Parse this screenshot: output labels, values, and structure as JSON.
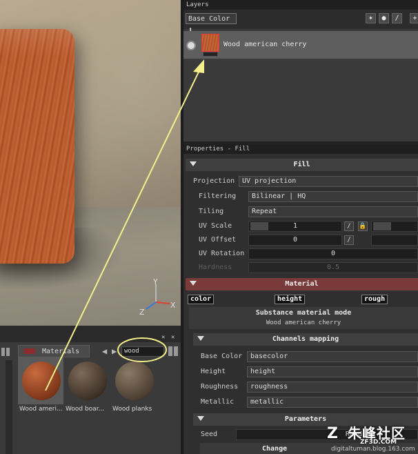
{
  "viewport": {
    "axes": {
      "y": "Y",
      "z": "Z",
      "x": "X"
    }
  },
  "layers": {
    "title": "Layers",
    "blend_mode": "Base Color ⬍",
    "tools": [
      "✶",
      "●",
      "∕",
      "+"
    ],
    "layer": {
      "name": "Wood american cherry"
    }
  },
  "properties": {
    "title": "Properties - Fill",
    "fill": {
      "title": "Fill",
      "projection": {
        "label": "Projection",
        "value": "UV projection"
      },
      "filtering": {
        "label": "Filtering",
        "value": "Bilinear | HQ"
      },
      "tiling": {
        "label": "Tiling",
        "value": "Repeat"
      },
      "uv_scale": {
        "label": "UV Scale",
        "value": "1"
      },
      "uv_offset": {
        "label": "UV Offset",
        "value": "0"
      },
      "uv_rotation": {
        "label": "UV Rotation",
        "value": "0"
      },
      "hardness": {
        "label": "Hardness",
        "value": "0.5"
      }
    },
    "material": {
      "title": "Material",
      "channels": [
        "color",
        "height",
        "rough"
      ],
      "mode_title": "Substance material mode",
      "mode_value": "Wood american cherry"
    },
    "channels_mapping": {
      "title": "Channels mapping",
      "rows": [
        {
          "label": "Base Color",
          "value": "basecolor"
        },
        {
          "label": "Height",
          "value": "height"
        },
        {
          "label": "Roughness",
          "value": "roughness"
        },
        {
          "label": "Metallic",
          "value": "metallic"
        }
      ]
    },
    "parameters": {
      "title": "Parameters",
      "seed": {
        "label": "Seed",
        "value": "Rand"
      },
      "changes_label": "Change"
    }
  },
  "shelf": {
    "tab_label": "Materials",
    "search_value": "wood",
    "items": [
      {
        "name": "Wood ameri...",
        "color_a": "#c86a3e",
        "color_b": "#7a3318"
      },
      {
        "name": "Wood boar...",
        "color_a": "#7d6a58",
        "color_b": "#3a2e24"
      },
      {
        "name": "Wood planks",
        "color_a": "#8a7a66",
        "color_b": "#4a3c30"
      }
    ]
  },
  "watermark": {
    "logo": "Z",
    "site_cn": "朱峰社区",
    "site_url": "ZF3D.COM",
    "blog": "digitaltuman.blog.163.com"
  },
  "colors": {
    "annotation": "#f4f08a",
    "material_bar": "#7a3a3a",
    "layer_row": "#5e5e5e"
  }
}
